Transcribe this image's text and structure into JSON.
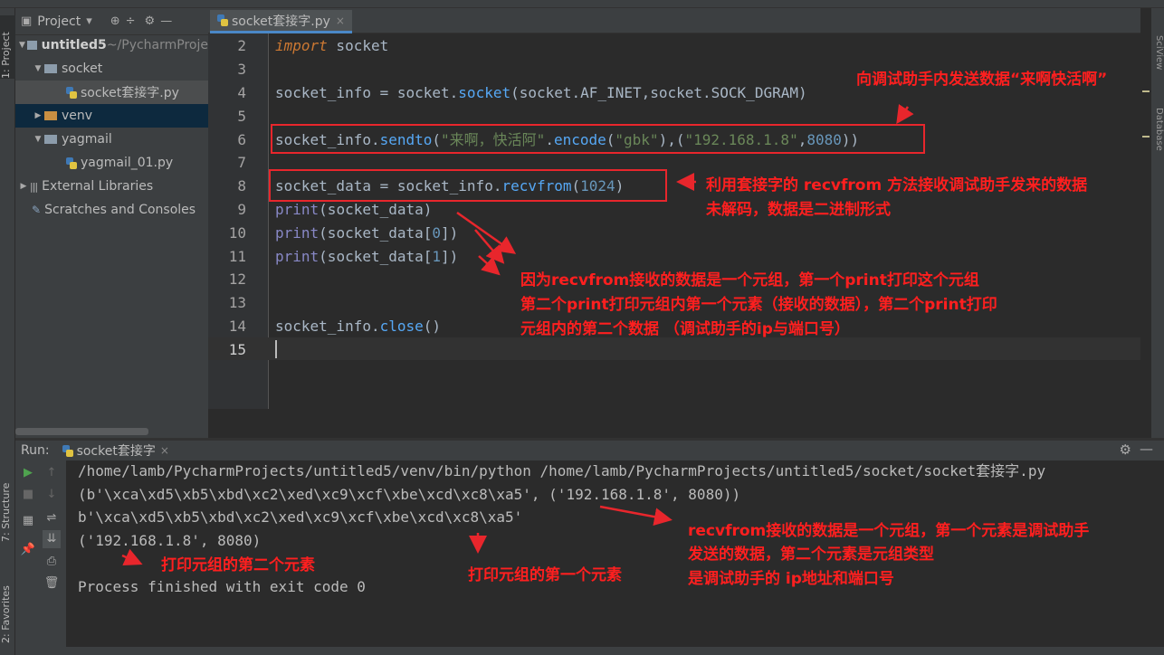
{
  "project": {
    "header_label": "Project",
    "tree": [
      {
        "label": "untitled5",
        "suffix": " ~/PycharmProje"
      },
      {
        "label": "socket"
      },
      {
        "label": "socket套接字.py"
      },
      {
        "label": "venv"
      },
      {
        "label": "yagmail"
      },
      {
        "label": "yagmail_01.py"
      },
      {
        "label": "External Libraries"
      },
      {
        "label": "Scratches and Consoles"
      }
    ]
  },
  "left_stripe": {
    "project_tab": "1: Project",
    "structure_tab": "7: Structure",
    "favorites_tab": "2: Favorites"
  },
  "right_stripe": {
    "sciview_tab": "SciView",
    "database_tab": "Database"
  },
  "editor": {
    "tab_label": "socket套接字.py",
    "line_numbers": [
      "2",
      "3",
      "4",
      "5",
      "6",
      "7",
      "8",
      "9",
      "10",
      "11",
      "12",
      "13",
      "14",
      "15"
    ],
    "code": {
      "l2_kw": "import",
      "l2_rest": " socket",
      "l4_a": "socket_info = socket.",
      "l4_call": "socket",
      "l4_b": "(socket.AF_INET,socket.SOCK_DGRAM)",
      "l6_a": "socket_info.",
      "l6_call": "sendto",
      "l6_b": "(",
      "l6_str1": "\"来啊，快活阿\"",
      "l6_c": ".",
      "l6_call2": "encode",
      "l6_d": "(",
      "l6_str2": "\"gbk\"",
      "l6_e": "),(",
      "l6_str3": "\"192.168.1.8\"",
      "l6_f": ",",
      "l6_num": "8080",
      "l6_g": "))",
      "l8_a": "socket_data = socket_info.",
      "l8_call": "recvfrom",
      "l8_b": "(",
      "l8_num": "1024",
      "l8_c": ")",
      "l9_fn": "print",
      "l9_rest": "(socket_data)",
      "l10_fn": "print",
      "l10_a": "(socket_data[",
      "l10_num": "0",
      "l10_b": "])",
      "l11_fn": "print",
      "l11_a": "(socket_data[",
      "l11_num": "1",
      "l11_b": "])",
      "l14_a": "socket_info.",
      "l14_call": "close",
      "l14_b": "()"
    }
  },
  "run": {
    "label": "Run:",
    "tab_label": "socket套接字",
    "console": [
      "/home/lamb/PycharmProjects/untitled5/venv/bin/python /home/lamb/PycharmProjects/untitled5/socket/socket套接字.py",
      "(b'\\xca\\xd5\\xb5\\xbd\\xc2\\xed\\xc9\\xcf\\xbe\\xcd\\xc8\\xa5', ('192.168.1.8', 8080))",
      "b'\\xca\\xd5\\xb5\\xbd\\xc2\\xed\\xc9\\xcf\\xbe\\xcd\\xc8\\xa5'",
      "('192.168.1.8', 8080)",
      "",
      "Process finished with exit code 0"
    ]
  },
  "annotations": {
    "a1": "向调试助手内发送数据“来啊快活啊”",
    "a2_l1": "利用套接字的 recvfrom 方法接收调试助手发来的数据",
    "a2_l2": "未解码，数据是二进制形式",
    "a3_l1": "因为recvfrom接收的数据是一个元组，第一个print打印这个元组",
    "a3_l2": "第二个print打印元组内第一个元素（接收的数据），第二个print打印",
    "a3_l3": "元组内的第二个数据 （调试助手的ip与端口号）",
    "a4_l1": "recvfrom接收的数据是一个元组，第一个元素是调试助手",
    "a4_l2": "发送的数据，第二个元素是元组类型",
    "a4_l3": "是调试助手的 ip地址和端口号",
    "a5": "打印元组的第二个元素",
    "a6": "打印元组的第一个元素"
  },
  "colors": {
    "annotation_red": "#ff1f1f",
    "keyword": "#cc7832",
    "string": "#6a8759",
    "number": "#6897bb",
    "builtin": "#8888c6"
  }
}
